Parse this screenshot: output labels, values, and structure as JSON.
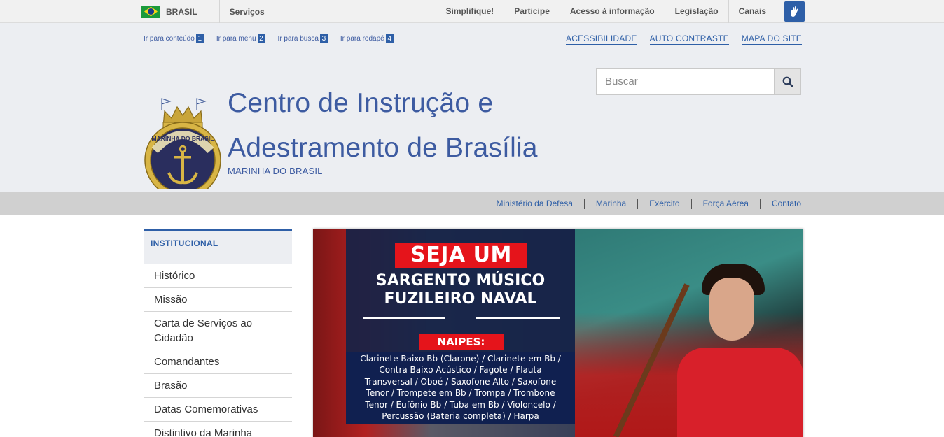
{
  "govbar": {
    "country": "BRASIL",
    "services": "Serviços",
    "links": [
      "Simplifique!",
      "Participe",
      "Acesso à informação",
      "Legislação",
      "Canais"
    ]
  },
  "skips": [
    {
      "label": "Ir para conteúdo",
      "num": "1"
    },
    {
      "label": "Ir para menu",
      "num": "2"
    },
    {
      "label": "Ir para busca",
      "num": "3"
    },
    {
      "label": "Ir para rodapé",
      "num": "4"
    }
  ],
  "toplinks": [
    "ACESSIBILIDADE",
    "AUTO CONTRASTE",
    "MAPA DO SITE"
  ],
  "search": {
    "placeholder": "Buscar"
  },
  "site": {
    "title_line1": "Centro de Instrução e",
    "title_line2": "Adestramento de Brasília",
    "subtitle": "MARINHA DO BRASIL",
    "emblem_text": "MARINHA DO BRASIL"
  },
  "subnav": [
    "Ministério da Defesa",
    "Marinha",
    "Exército",
    "Força Aérea",
    "Contato"
  ],
  "sidebar": {
    "heading": "INSTITUCIONAL",
    "items": [
      "Histórico",
      "Missão",
      "Carta de Serviços ao Cidadão",
      "Comandantes",
      "Brasão",
      "Datas Comemorativas",
      "Distintivo da Marinha"
    ]
  },
  "banner": {
    "seja": "SEJA UM",
    "line1": "SARGENTO MÚSICO",
    "line2": "FUZILEIRO NAVAL",
    "naipes": "NAIPES:",
    "instruments": "Clarinete Baixo Bb (Clarone) / Clarinete em Bb / Contra Baixo Acústico / Fagote / Flauta Transversal / Oboé / Saxofone Alto / Saxofone Tenor / Trompete em Bb / Trompa / Trombone Tenor / Eufônio Bb / Tuba em Bb / Violoncelo / Percussão (Bateria completa) / Harpa"
  },
  "colors": {
    "brand": "#2e5fa7",
    "accent_red": "#e5141b",
    "navy": "#102050"
  }
}
